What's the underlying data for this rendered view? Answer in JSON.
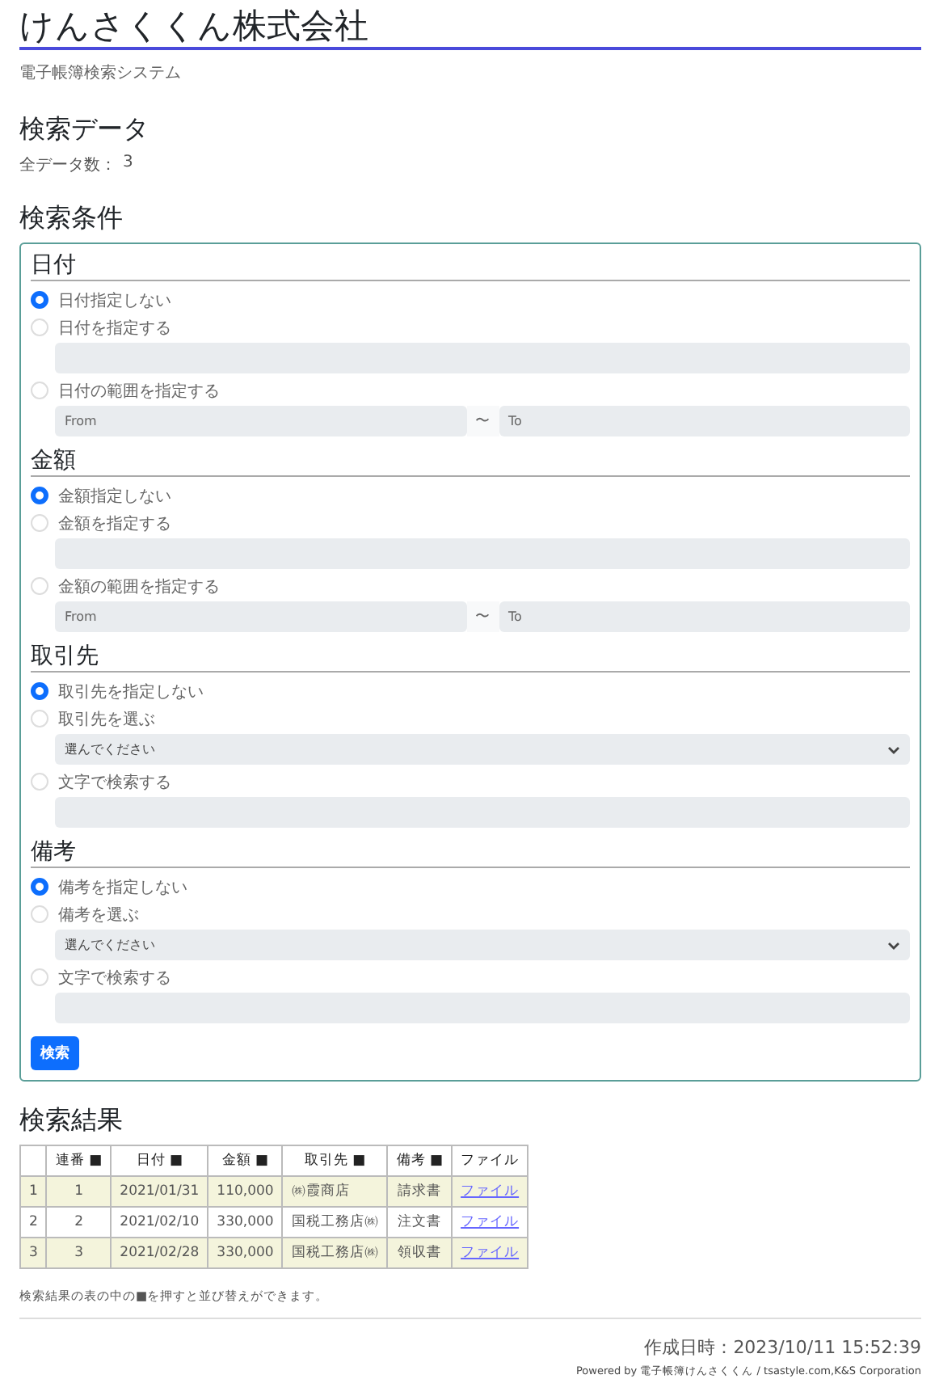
{
  "header": {
    "title": "けんさくくん株式会社",
    "subtitle": "電子帳簿検索システム"
  },
  "data_section": {
    "heading": "検索データ",
    "count_label": "全データ数：",
    "count": "3"
  },
  "search_section": {
    "heading": "検索条件",
    "groups": [
      {
        "title": "日付",
        "options": [
          {
            "label": "日付指定しない",
            "selected": true
          },
          {
            "label": "日付を指定する",
            "selected": false,
            "kind": "text"
          },
          {
            "label": "日付の範囲を指定する",
            "selected": false,
            "kind": "range",
            "from": "From",
            "separator": "〜",
            "to": "To"
          }
        ]
      },
      {
        "title": "金額",
        "options": [
          {
            "label": "金額指定しない",
            "selected": true
          },
          {
            "label": "金額を指定する",
            "selected": false,
            "kind": "text"
          },
          {
            "label": "金額の範囲を指定する",
            "selected": false,
            "kind": "range",
            "from": "From",
            "separator": "〜",
            "to": "To"
          }
        ]
      },
      {
        "title": "取引先",
        "options": [
          {
            "label": "取引先を指定しない",
            "selected": true
          },
          {
            "label": "取引先を選ぶ",
            "selected": false,
            "kind": "select",
            "placeholder": "選んでください"
          },
          {
            "label": "文字で検索する",
            "selected": false,
            "kind": "text"
          }
        ]
      },
      {
        "title": "備考",
        "options": [
          {
            "label": "備考を指定しない",
            "selected": true
          },
          {
            "label": "備考を選ぶ",
            "selected": false,
            "kind": "select",
            "placeholder": "選んでください"
          },
          {
            "label": "文字で検索する",
            "selected": false,
            "kind": "text"
          }
        ]
      }
    ],
    "button": "検索"
  },
  "results": {
    "heading": "検索結果",
    "table": {
      "columns": [
        "",
        "連番 ■",
        "日付 ■",
        "金額 ■",
        "取引先 ■",
        "備考 ■",
        "ファイル"
      ],
      "rows": [
        [
          "1",
          "1",
          "2021/01/31",
          "110,000",
          "㈱霞商店",
          "請求書",
          "ファイル"
        ],
        [
          "2",
          "2",
          "2021/02/10",
          "330,000",
          "国税工務店㈱",
          "注文書",
          "ファイル"
        ],
        [
          "3",
          "3",
          "2021/02/28",
          "330,000",
          "国税工務店㈱",
          "領収書",
          "ファイル"
        ]
      ]
    },
    "note": "検索結果の表の中の■を押すと並び替えができます。"
  },
  "footer": {
    "created": "作成日時：2023/10/11 15:52:39",
    "powered": "Powered by 電子帳簿けんさくくん / tsastyle.com,K&S Corporation"
  }
}
